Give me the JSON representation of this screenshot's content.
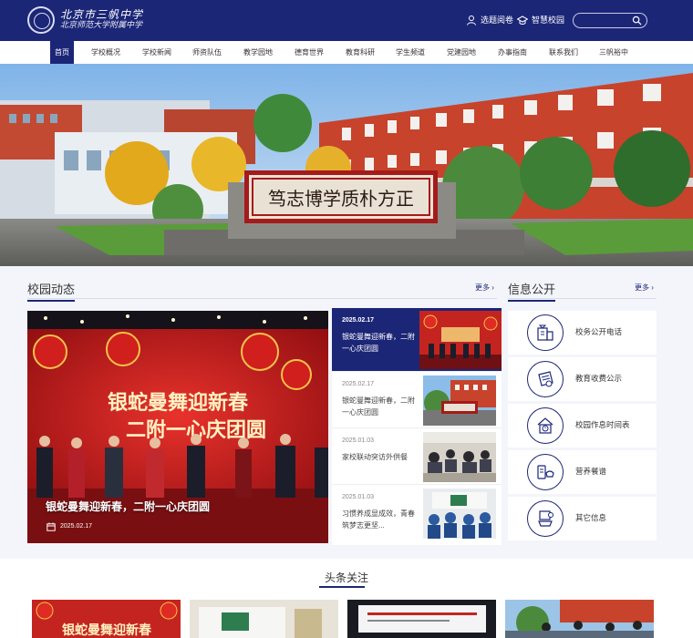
{
  "header": {
    "school_name": "北京市三帆中学",
    "school_sub": "北京师范大学附属中学",
    "links": [
      {
        "label": "选题阅卷",
        "icon": "user-icon"
      },
      {
        "label": "智慧校园",
        "icon": "graduation-cap-icon"
      }
    ],
    "search": {
      "placeholder": "",
      "icon": "search-icon"
    }
  },
  "nav": {
    "items": [
      "首页",
      "学校概况",
      "学校新闻",
      "师资队伍",
      "教学园地",
      "德育世界",
      "教育科研",
      "学生频道",
      "党建园地",
      "办事指南",
      "联系我们",
      "三帆裕中"
    ],
    "active_index": 0
  },
  "hero": {
    "sign_text": "笃志博学质朴方正"
  },
  "campus_news": {
    "title": "校园动态",
    "more": "更多",
    "featured": {
      "caption": "银蛇曼舞迎新春，二附一心庆团圆",
      "date": "2025.02.17"
    },
    "banner_text": [
      "银蛇曼舞迎新春",
      "二附一心庆团圆"
    ],
    "items": [
      {
        "date": "2025.02.17",
        "title": "银蛇曼舞迎新春，二附一心庆团圆",
        "active": true
      },
      {
        "date": "2025.02.17",
        "title": "银蛇曼舞迎新春，二附一心庆团圆",
        "active": false
      },
      {
        "date": "2025.01.03",
        "title": "家校联动突访外供餐",
        "active": false
      },
      {
        "date": "2025.01.03",
        "title": "习惯养成显成效，青春筑梦志更坚...",
        "active": false
      }
    ]
  },
  "info_public": {
    "title": "信息公开",
    "more": "更多",
    "items": [
      {
        "label": "校务公开电话",
        "icon": "phone-building-icon"
      },
      {
        "label": "教育收费公示",
        "icon": "fee-document-icon"
      },
      {
        "label": "校园作息时间表",
        "icon": "schedule-house-icon"
      },
      {
        "label": "营养餐谱",
        "icon": "meal-icon"
      },
      {
        "label": "其它信息",
        "icon": "info-screen-icon"
      }
    ]
  },
  "headline": {
    "title": "头条关注",
    "card_texts": [
      "银蛇曼舞迎新春"
    ]
  },
  "colors": {
    "brand": "#1c2677",
    "accent_red": "#c8161d",
    "background": "#f3f5fa"
  }
}
